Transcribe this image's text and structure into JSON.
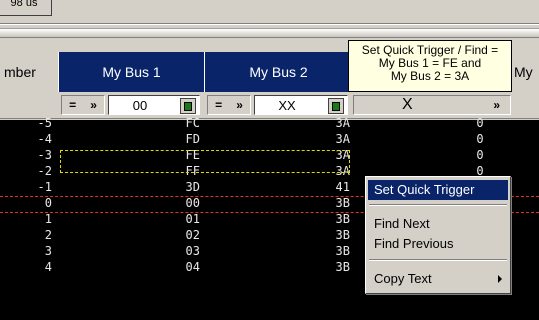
{
  "top_button_fragment": "98 us",
  "headers": {
    "number": "mber",
    "bus1": "My Bus 1",
    "bus2": "My Bus 2",
    "extra": "My"
  },
  "filters": {
    "bus1": {
      "operator": "=",
      "operator_arrow": "»",
      "value": "00"
    },
    "bus2": {
      "operator": "=",
      "operator_arrow": "»",
      "value": "XX"
    },
    "bus3": {
      "value": "X",
      "arrow": "»"
    }
  },
  "rows": [
    {
      "num": "-5",
      "bus1": "FC",
      "bus2": "3A",
      "col3": "0"
    },
    {
      "num": "-4",
      "bus1": "FD",
      "bus2": "3A",
      "col3": "0"
    },
    {
      "num": "-3",
      "bus1": "FE",
      "bus2": "3A",
      "col3": "0"
    },
    {
      "num": "-2",
      "bus1": "FF",
      "bus2": "3A",
      "col3": "0"
    },
    {
      "num": "-1",
      "bus1": "3D",
      "bus2": "41",
      "col3": ""
    },
    {
      "num": "0",
      "bus1": "00",
      "bus2": "3B",
      "col3": ""
    },
    {
      "num": "1",
      "bus1": "01",
      "bus2": "3B",
      "col3": ""
    },
    {
      "num": "2",
      "bus1": "02",
      "bus2": "3B",
      "col3": ""
    },
    {
      "num": "3",
      "bus1": "03",
      "bus2": "3B",
      "col3": ""
    },
    {
      "num": "4",
      "bus1": "04",
      "bus2": "3B",
      "col3": "0"
    }
  ],
  "tooltip": {
    "line1": "Set Quick Trigger / Find =",
    "line2": "My Bus 1 = FE and",
    "line3": "My Bus 2 = 3A"
  },
  "context_menu": {
    "items": [
      "Set Quick Trigger",
      "Find Next",
      "Find Previous",
      "Copy Text"
    ],
    "selected": "Set Quick Trigger"
  },
  "colors": {
    "header_blue": "#0a246a",
    "grid_bg": "#000000",
    "highlight_yellow": "#e8d800",
    "marker_red": "#e03030"
  }
}
